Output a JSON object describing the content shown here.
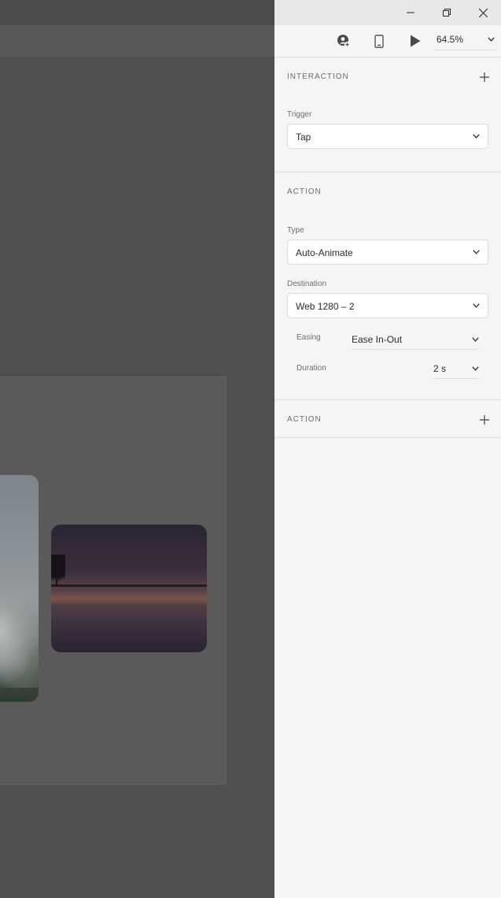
{
  "toolbar": {
    "zoom_value": "64.5%",
    "icons": [
      "share-user-icon",
      "device-preview-icon",
      "play-icon",
      "chevron-down-icon"
    ]
  },
  "window_controls": [
    "minimize-icon",
    "restore-icon",
    "close-icon"
  ],
  "interaction": {
    "title": "INTERACTION",
    "trigger_label": "Trigger",
    "trigger_value": "Tap"
  },
  "action": {
    "title": "ACTION",
    "type_label": "Type",
    "type_value": "Auto-Animate",
    "destination_label": "Destination",
    "destination_value": "Web 1280 – 2",
    "easing_label": "Easing",
    "easing_value": "Ease In-Out",
    "duration_label": "Duration",
    "duration_value": "2 s"
  },
  "action2": {
    "title": "ACTION"
  },
  "colors": {
    "panel_bg": "#f5f5f5",
    "canvas_overlay": "#505050",
    "text": "#2c2c2c",
    "muted": "#6e6e6e"
  }
}
